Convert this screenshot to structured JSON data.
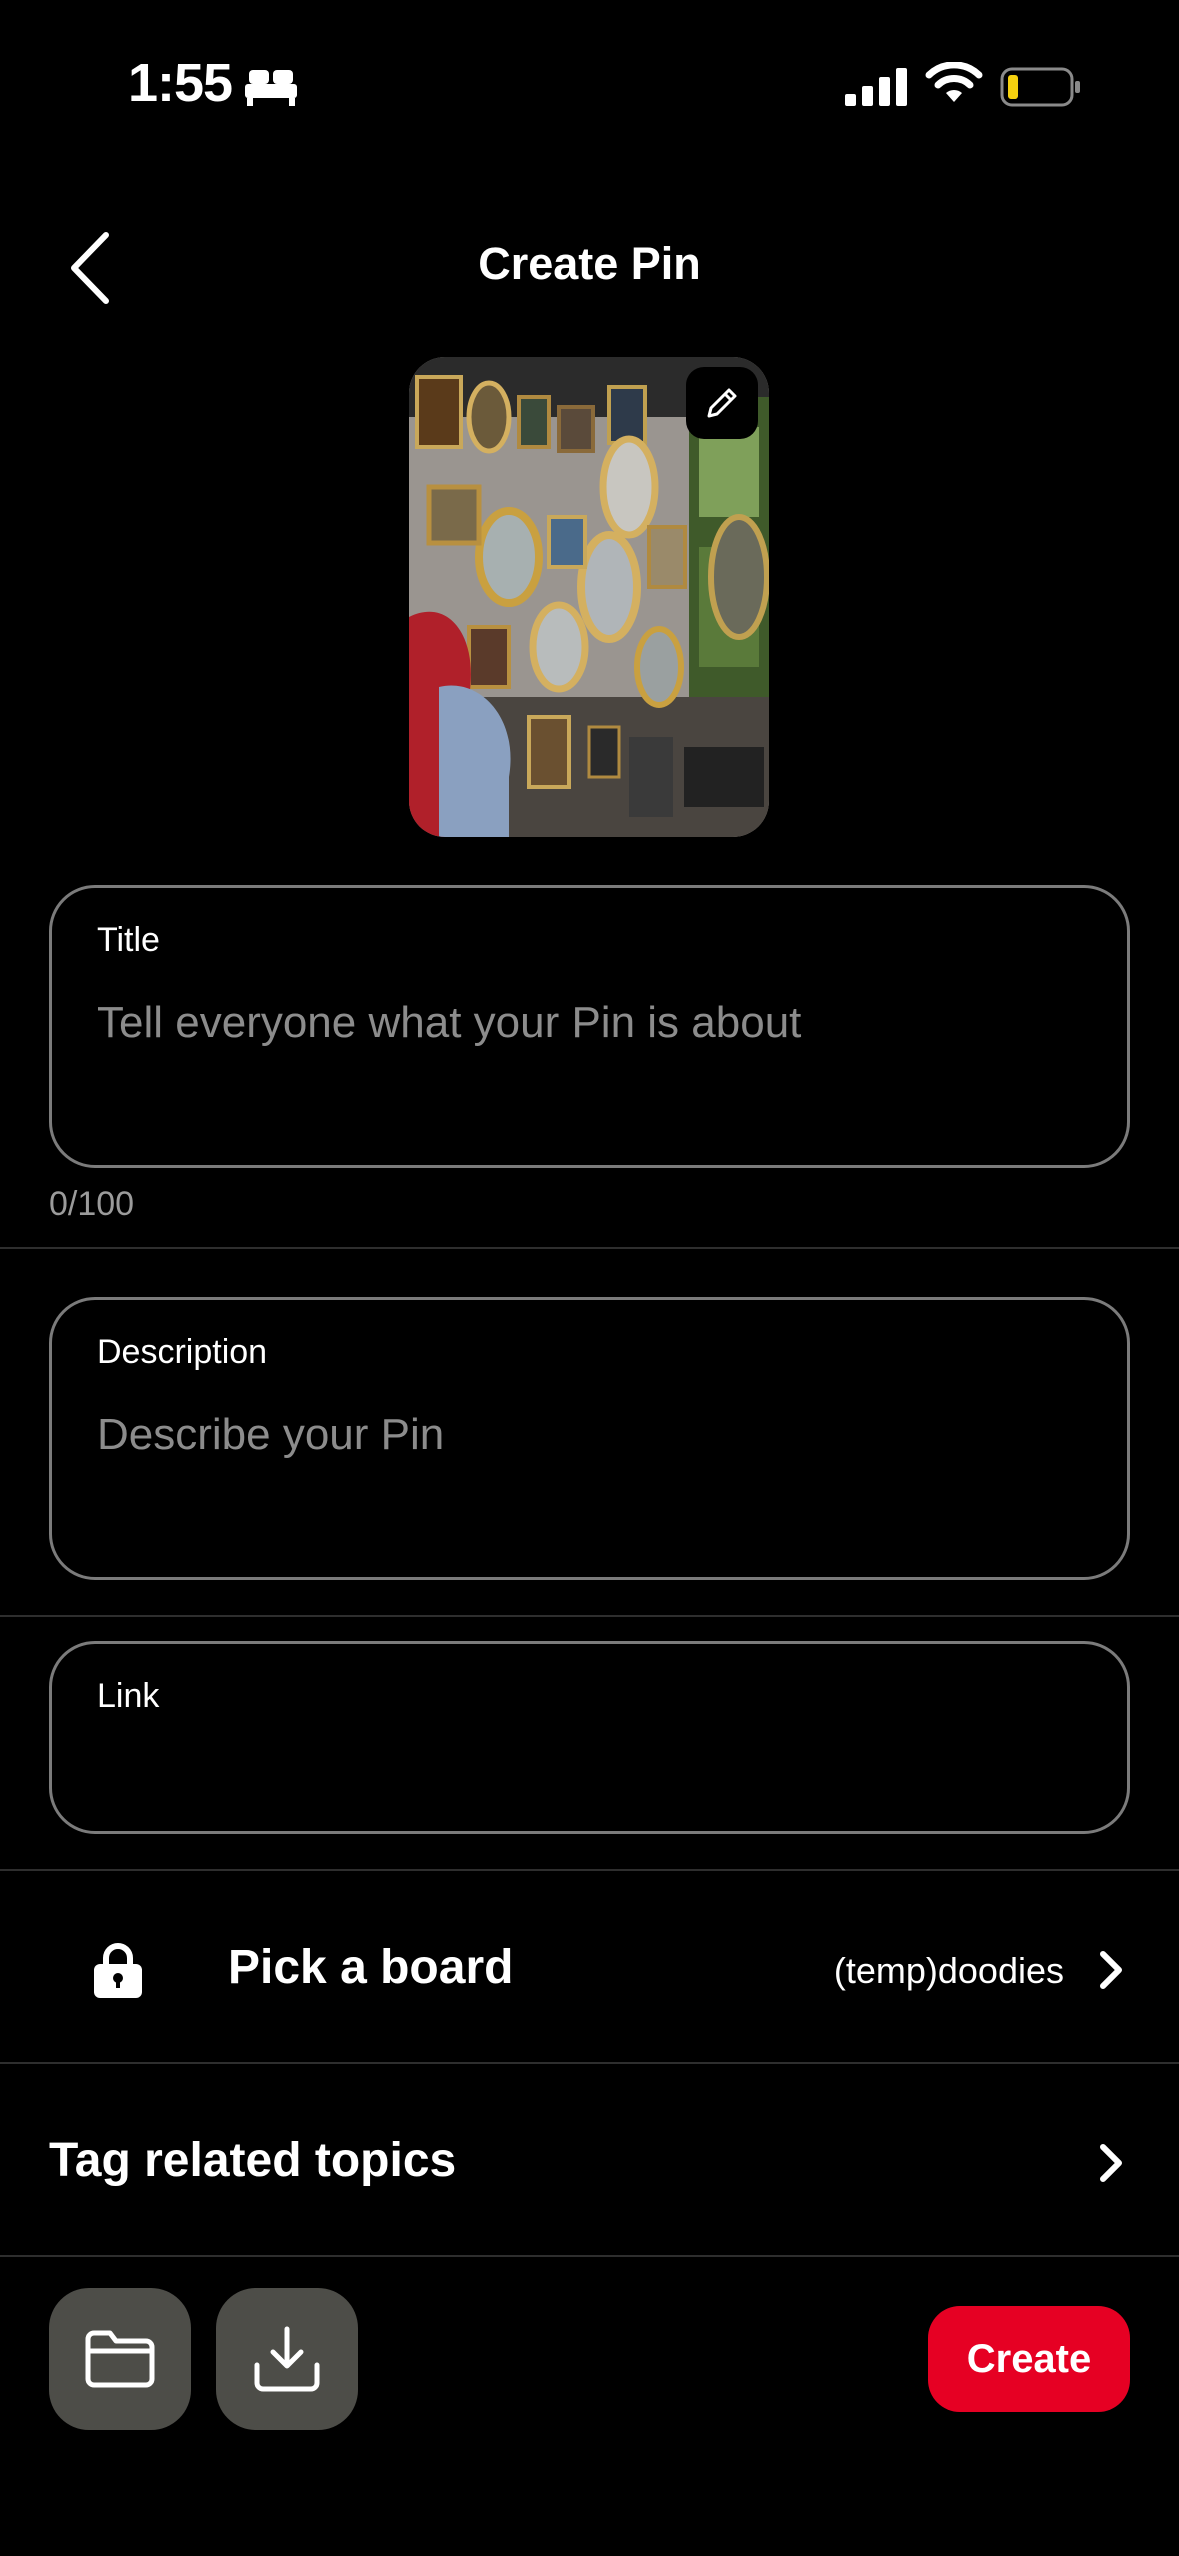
{
  "status_bar": {
    "time": "1:55",
    "icons": [
      "bed-icon",
      "signal-icon",
      "wifi-icon",
      "battery-icon"
    ]
  },
  "header": {
    "title": "Create Pin",
    "back_icon": "chevron-left-icon"
  },
  "pin_image": {
    "edit_icon": "pencil-icon"
  },
  "form": {
    "title": {
      "label": "Title",
      "placeholder": "Tell everyone what your Pin is about",
      "value": "",
      "counter": "0/100"
    },
    "description": {
      "label": "Description",
      "placeholder": "Describe your Pin",
      "value": ""
    },
    "link": {
      "label": "Link",
      "value": ""
    }
  },
  "board": {
    "label": "Pick a board",
    "value": "(temp)doodies",
    "icon": "lock-icon"
  },
  "topics": {
    "label": "Tag related topics"
  },
  "bottom_bar": {
    "folder_icon": "folder-icon",
    "download_icon": "download-icon",
    "create_label": "Create"
  },
  "colors": {
    "background": "#000000",
    "accent": "#e60023",
    "tool_button": "#4d4d48",
    "field_border": "#7b7b7b"
  }
}
